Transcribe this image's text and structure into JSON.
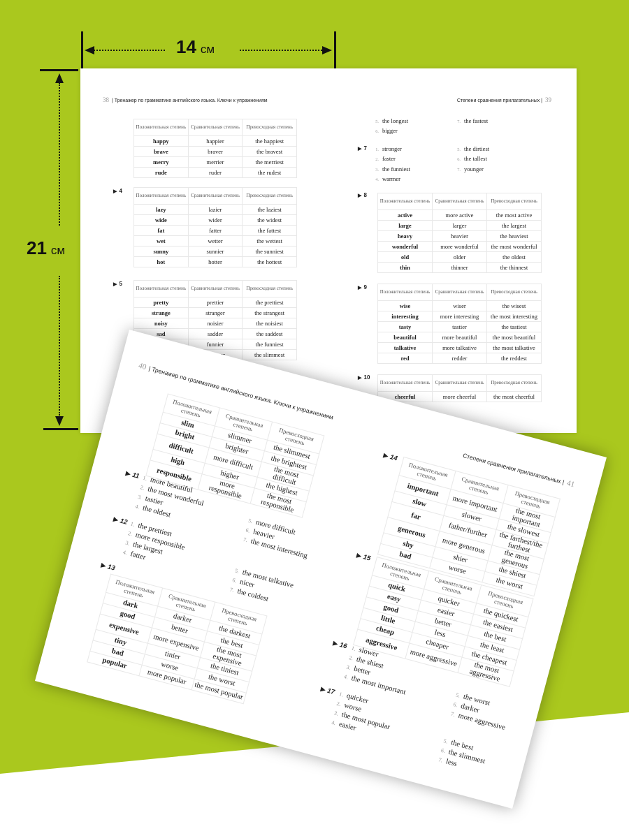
{
  "dimensions": {
    "width_value": "14",
    "width_unit": "см",
    "height_value": "21",
    "height_unit": "см"
  },
  "colors": {
    "background_green": "#aac81e",
    "page": "#ffffff"
  },
  "table_headers": [
    "Положительная степень",
    "Сравнительная степень",
    "Превосходная степень"
  ],
  "spread1": {
    "left": {
      "page_number": "38",
      "running_head": "Тренажер по грамматике английского языка. Ключи к упражнениям",
      "ex3": {
        "rows": [
          [
            "happy",
            "happier",
            "the happiest"
          ],
          [
            "brave",
            "braver",
            "the bravest"
          ],
          [
            "merry",
            "merrier",
            "the merriest"
          ],
          [
            "rude",
            "ruder",
            "the rudest"
          ]
        ]
      },
      "ex4": {
        "label": "4",
        "rows": [
          [
            "lazy",
            "lazier",
            "the laziest"
          ],
          [
            "wide",
            "wider",
            "the widest"
          ],
          [
            "fat",
            "fatter",
            "the fattest"
          ],
          [
            "wet",
            "wetter",
            "the wettest"
          ],
          [
            "sunny",
            "sunnier",
            "the sunniest"
          ],
          [
            "hot",
            "hotter",
            "the hottest"
          ]
        ]
      },
      "ex5": {
        "label": "5",
        "rows": [
          [
            "pretty",
            "prettier",
            "the prettiest"
          ],
          [
            "strange",
            "stranger",
            "the strangest"
          ],
          [
            "noisy",
            "noisier",
            "the noisiest"
          ],
          [
            "sad",
            "sadder",
            "the saddest"
          ],
          [
            "",
            "funnier",
            "the funniest"
          ],
          [
            "",
            "slimmer",
            "the slimmest"
          ]
        ]
      }
    },
    "right": {
      "page_number": "39",
      "running_head": "Степени сравнения прилагательных",
      "ex6": {
        "col1": [
          {
            "n": "5.",
            "t": "the longest"
          },
          {
            "n": "6.",
            "t": "bigger"
          }
        ],
        "col2": [
          {
            "n": "7.",
            "t": "the fastest"
          }
        ]
      },
      "ex7": {
        "label": "7",
        "col1": [
          {
            "n": "1.",
            "t": "stronger"
          },
          {
            "n": "2.",
            "t": "faster"
          },
          {
            "n": "3.",
            "t": "the funniest"
          },
          {
            "n": "4.",
            "t": "warmer"
          }
        ],
        "col2": [
          {
            "n": "5.",
            "t": "the dirtiest"
          },
          {
            "n": "6.",
            "t": "the tallest"
          },
          {
            "n": "7.",
            "t": "younger"
          }
        ]
      },
      "ex8": {
        "label": "8",
        "rows": [
          [
            "active",
            "more active",
            "the most active"
          ],
          [
            "large",
            "larger",
            "the largest"
          ],
          [
            "heavy",
            "heavier",
            "the heaviest"
          ],
          [
            "wonderful",
            "more wonderful",
            "the most wonderful"
          ],
          [
            "old",
            "older",
            "the oldest"
          ],
          [
            "thin",
            "thinner",
            "the thinnest"
          ]
        ]
      },
      "ex9": {
        "label": "9",
        "rows": [
          [
            "wise",
            "wiser",
            "the wisest"
          ],
          [
            "interesting",
            "more interesting",
            "the most interesting"
          ],
          [
            "tasty",
            "tastier",
            "the tastiest"
          ],
          [
            "beautiful",
            "more beautiful",
            "the most beautiful"
          ],
          [
            "talkative",
            "more talkative",
            "the most talkative"
          ],
          [
            "red",
            "redder",
            "the reddest"
          ]
        ]
      },
      "ex10": {
        "label": "10",
        "rows": [
          [
            "cheerful",
            "more cheerful",
            "the most cheerful"
          ]
        ]
      }
    }
  },
  "spread2": {
    "left": {
      "page_number": "40",
      "running_head": "Тренажер по грамматике английского языка. Ключи к упражнениям",
      "ex10": {
        "rows": [
          [
            "slim",
            "slimmer",
            "the slimmest"
          ],
          [
            "bright",
            "brighter",
            "the brightest"
          ],
          [
            "difficult",
            "more difficult",
            "the most difficult"
          ],
          [
            "high",
            "higher",
            "the highest"
          ],
          [
            "responsible",
            "more responsible",
            "the most responsible"
          ]
        ]
      },
      "ex11": {
        "label": "11",
        "col1": [
          {
            "n": "1.",
            "t": "more beautiful"
          },
          {
            "n": "2.",
            "t": "the most wonderful"
          },
          {
            "n": "3.",
            "t": "tastier"
          },
          {
            "n": "4.",
            "t": "the oldest"
          }
        ],
        "col2": [
          {
            "n": "5.",
            "t": "more difficult"
          },
          {
            "n": "6.",
            "t": "heavier"
          },
          {
            "n": "7.",
            "t": "the most interesting"
          }
        ]
      },
      "ex12": {
        "label": "12",
        "col1": [
          {
            "n": "1.",
            "t": "the prettiest"
          },
          {
            "n": "2.",
            "t": "more responsible"
          },
          {
            "n": "3.",
            "t": "the largest"
          },
          {
            "n": "4.",
            "t": "fatter"
          }
        ],
        "col2": [
          {
            "n": "5.",
            "t": "the most talkative"
          },
          {
            "n": "6.",
            "t": "nicer"
          },
          {
            "n": "7.",
            "t": "the coldest"
          }
        ]
      },
      "ex13": {
        "label": "13",
        "rows": [
          [
            "dark",
            "darker",
            "the darkest"
          ],
          [
            "good",
            "better",
            "the best"
          ],
          [
            "expensive",
            "more expensive",
            "the most expensive"
          ],
          [
            "tiny",
            "tinier",
            "the tiniest"
          ],
          [
            "bad",
            "worse",
            "the worst"
          ],
          [
            "popular",
            "more popular",
            "the most popular"
          ]
        ]
      }
    },
    "right": {
      "page_number": "41",
      "running_head": "Степени сравнения прилагательных",
      "ex14": {
        "label": "14",
        "rows": [
          [
            "important",
            "more important",
            "the most important"
          ],
          [
            "slow",
            "slower",
            "the slowest"
          ],
          [
            "far",
            "father/further",
            "the farthest/the furthest"
          ],
          [
            "generous",
            "more generous",
            "the most generous"
          ],
          [
            "shy",
            "shier",
            "the shiest"
          ],
          [
            "bad",
            "worse",
            "the worst"
          ]
        ]
      },
      "ex15": {
        "label": "15",
        "rows": [
          [
            "quick",
            "quicker",
            "the quickest"
          ],
          [
            "easy",
            "easier",
            "the easiest"
          ],
          [
            "good",
            "better",
            "the best"
          ],
          [
            "little",
            "less",
            "the least"
          ],
          [
            "cheap",
            "cheaper",
            "the cheapest"
          ],
          [
            "aggressive",
            "more aggressive",
            "the most aggressive"
          ]
        ]
      },
      "ex16": {
        "label": "16",
        "col1": [
          {
            "n": "1.",
            "t": "slower"
          },
          {
            "n": "2.",
            "t": "the shiest"
          },
          {
            "n": "3.",
            "t": "better"
          },
          {
            "n": "4.",
            "t": "the most important"
          }
        ],
        "col2": [
          {
            "n": "5.",
            "t": "the worst"
          },
          {
            "n": "6.",
            "t": "darker"
          },
          {
            "n": "7.",
            "t": "more aggressive"
          }
        ]
      },
      "ex17": {
        "label": "17",
        "col1": [
          {
            "n": "1.",
            "t": "quicker"
          },
          {
            "n": "2.",
            "t": "worse"
          },
          {
            "n": "3.",
            "t": "the most popular"
          },
          {
            "n": "4.",
            "t": "easier"
          }
        ],
        "col2": [
          {
            "n": "5.",
            "t": "the best"
          },
          {
            "n": "6.",
            "t": "the slimmest"
          },
          {
            "n": "7.",
            "t": "less"
          }
        ]
      }
    }
  }
}
